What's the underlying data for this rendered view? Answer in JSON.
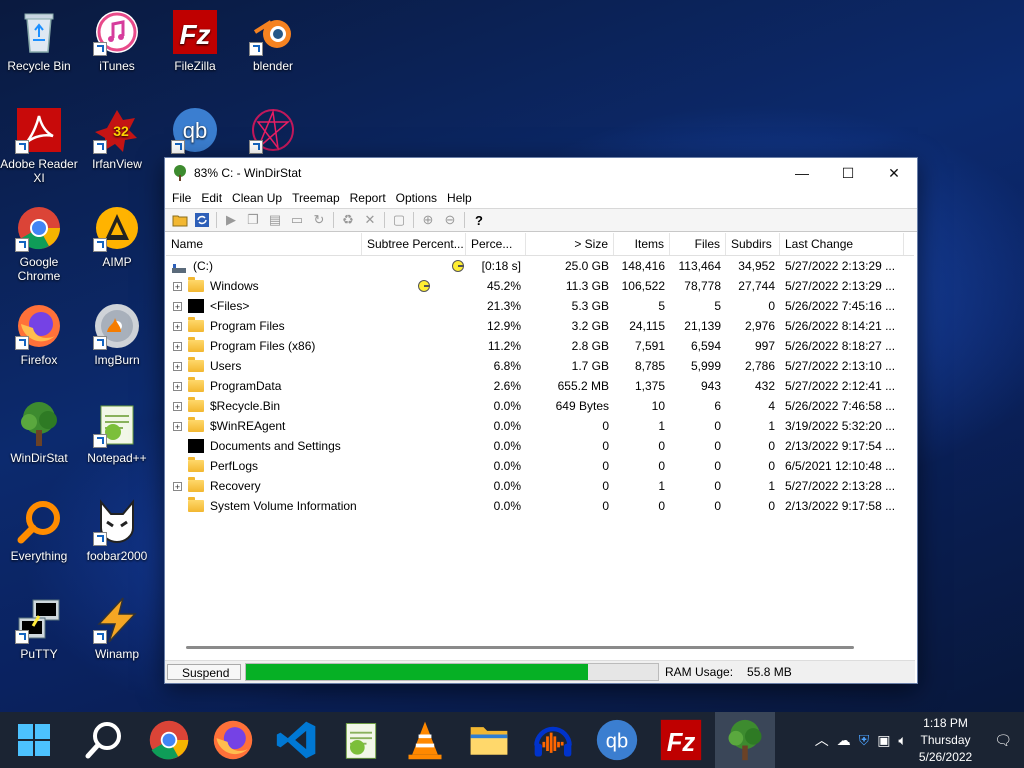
{
  "desktop": {
    "icons": [
      {
        "label": "Recycle Bin"
      },
      {
        "label": "iTunes"
      },
      {
        "label": "FileZilla"
      },
      {
        "label": "blender"
      },
      {
        "label": "Adobe Reader XI"
      },
      {
        "label": "IrfanView"
      },
      {
        "label": "Google Chrome"
      },
      {
        "label": "AIMP"
      },
      {
        "label": "Firefox"
      },
      {
        "label": "ImgBurn"
      },
      {
        "label": "WinDirStat"
      },
      {
        "label": "Notepad++"
      },
      {
        "label": "Everything"
      },
      {
        "label": "foobar2000"
      },
      {
        "label": "PuTTY"
      },
      {
        "label": "Winamp"
      }
    ],
    "irfan_badge": "32"
  },
  "window": {
    "title": "83% C: - WinDirStat",
    "menu": [
      "File",
      "Edit",
      "Clean Up",
      "Treemap",
      "Report",
      "Options",
      "Help"
    ],
    "controls": {
      "minimize": "—",
      "maximize": "☐",
      "close": "✕"
    }
  },
  "table": {
    "headers": [
      "Name",
      "Subtree Percent...",
      "Perce...",
      "> Size",
      "Items",
      "Files",
      "Subdirs",
      "Last Change"
    ],
    "rows": [
      {
        "name": "(C:)",
        "pct": "[0:18 s]",
        "size": "25.0 GB",
        "items": "148,416",
        "files": "113,464",
        "subdirs": "34,952",
        "last": "5/27/2022 2:13:29 ..."
      },
      {
        "name": "Windows",
        "pct": "45.2%",
        "size": "11.3 GB",
        "items": "106,522",
        "files": "78,778",
        "subdirs": "27,744",
        "last": "5/27/2022 2:13:29 ..."
      },
      {
        "name": "<Files>",
        "pct": "21.3%",
        "size": "5.3 GB",
        "items": "5",
        "files": "5",
        "subdirs": "0",
        "last": "5/26/2022 7:45:16 ..."
      },
      {
        "name": "Program Files",
        "pct": "12.9%",
        "size": "3.2 GB",
        "items": "24,115",
        "files": "21,139",
        "subdirs": "2,976",
        "last": "5/26/2022 8:14:21 ..."
      },
      {
        "name": "Program Files (x86)",
        "pct": "11.2%",
        "size": "2.8 GB",
        "items": "7,591",
        "files": "6,594",
        "subdirs": "997",
        "last": "5/26/2022 8:18:27 ..."
      },
      {
        "name": "Users",
        "pct": "6.8%",
        "size": "1.7 GB",
        "items": "8,785",
        "files": "5,999",
        "subdirs": "2,786",
        "last": "5/27/2022 2:13:10 ..."
      },
      {
        "name": "ProgramData",
        "pct": "2.6%",
        "size": "655.2 MB",
        "items": "1,375",
        "files": "943",
        "subdirs": "432",
        "last": "5/27/2022 2:12:41 ..."
      },
      {
        "name": "$Recycle.Bin",
        "pct": "0.0%",
        "size": "649 Bytes",
        "items": "10",
        "files": "6",
        "subdirs": "4",
        "last": "5/26/2022 7:46:58 ..."
      },
      {
        "name": "$WinREAgent",
        "pct": "0.0%",
        "size": "0",
        "items": "1",
        "files": "0",
        "subdirs": "1",
        "last": "3/19/2022 5:32:20 ..."
      },
      {
        "name": "Documents and Settings",
        "pct": "0.0%",
        "size": "0",
        "items": "0",
        "files": "0",
        "subdirs": "0",
        "last": "2/13/2022 9:17:54 ..."
      },
      {
        "name": "PerfLogs",
        "pct": "0.0%",
        "size": "0",
        "items": "0",
        "files": "0",
        "subdirs": "0",
        "last": "6/5/2021 12:10:48 ..."
      },
      {
        "name": "Recovery",
        "pct": "0.0%",
        "size": "0",
        "items": "1",
        "files": "0",
        "subdirs": "1",
        "last": "5/27/2022 2:13:28 ..."
      },
      {
        "name": "System Volume Information",
        "pct": "0.0%",
        "size": "0",
        "items": "0",
        "files": "0",
        "subdirs": "0",
        "last": "2/13/2022 9:17:58 ..."
      }
    ]
  },
  "status": {
    "suspend_label": "Suspend",
    "progress": 0.83,
    "progress_color": "#06b025",
    "ram_label": "RAM Usage:",
    "ram_value": "55.8 MB"
  },
  "taskbar": {
    "time": "1:18 PM",
    "day": "Thursday",
    "date": "5/26/2022"
  }
}
